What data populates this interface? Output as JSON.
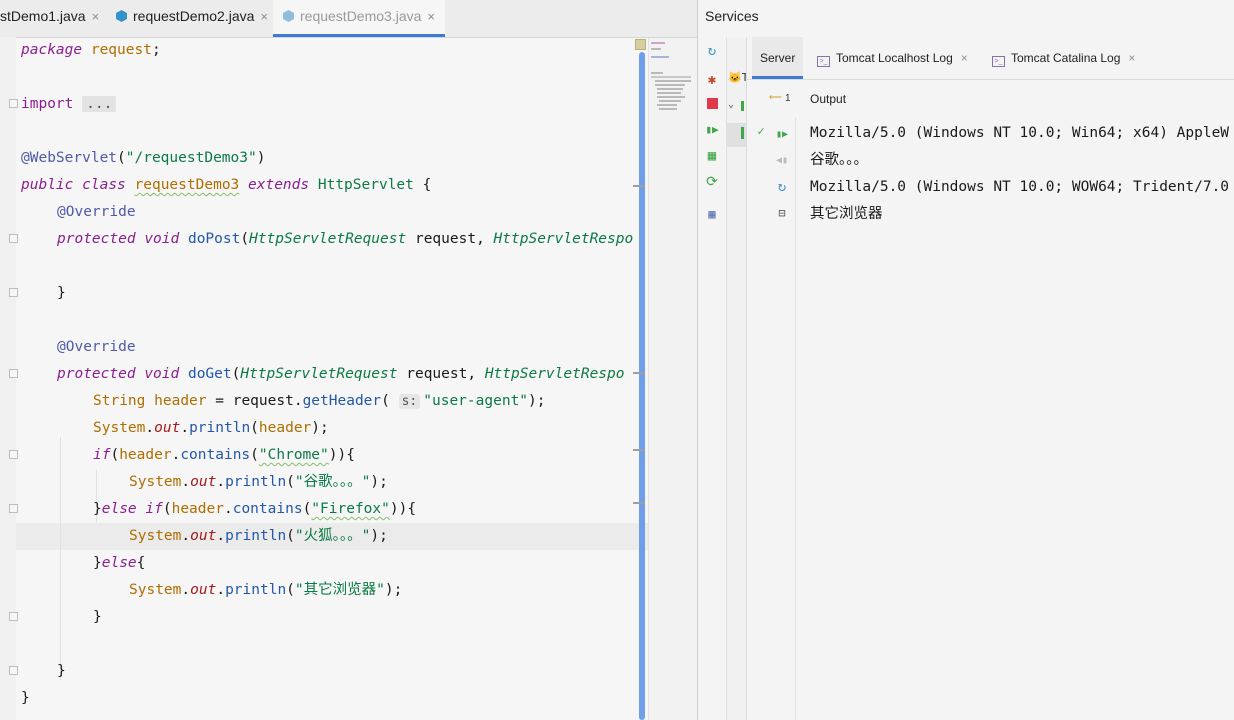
{
  "editor": {
    "tabs": [
      {
        "label": "stDemo1.java",
        "close": "×"
      },
      {
        "label": "requestDemo2.java",
        "close": "×"
      },
      {
        "label": "requestDemo3.java",
        "close": "×"
      }
    ],
    "code": {
      "package_kw": "package",
      "package_name": "request",
      "semicolon": ";",
      "import_kw": "import",
      "import_dots": "...",
      "ann_webservlet": "@WebServlet",
      "webservlet_paren_open": "(",
      "webservlet_path": "\"/requestDemo3\"",
      "webservlet_paren_close": ")",
      "public_kw": "public",
      "class_kw": "class",
      "class_name": "requestDemo3",
      "extends_kw": "extends",
      "super_class": "HttpServlet",
      "brace_open": "{",
      "override": "@Override",
      "protected_kw": "protected",
      "void_kw": "void",
      "do_post": "doPost",
      "param_type1": "HttpServletRequest",
      "param_request": "request,",
      "param_type2_post": "HttpServletRespo",
      "close_brace": "}",
      "do_get": "doGet",
      "param_type2_get": "HttpServletRespo",
      "string_type": "String",
      "header_var": "header",
      "equals": "=",
      "request_obj": "request",
      "get_header": "getHeader",
      "hint_s": "s:",
      "user_agent": "\"user-agent\"",
      "stmt_end": ");",
      "system": "System",
      "out": "out",
      "println": "println",
      "dot": ".",
      "if_kw": "if",
      "else_kw": "else",
      "contains": "contains",
      "chrome": "\"Chrome\"",
      "firefox": "\"Firefox\"",
      "msg_chrome": "\"谷歌。。。\"",
      "msg_firefox": "\"火狐。。。\"",
      "msg_other": "\"其它浏览器\""
    }
  },
  "services": {
    "title": "Services",
    "tree_node_label": "T",
    "log_tabs": [
      {
        "label": "Server"
      },
      {
        "label": "Tomcat Localhost Log",
        "close": "×"
      },
      {
        "label": "Tomcat Catalina Log",
        "close": "×"
      }
    ],
    "output_label": "Output",
    "output_indicator": "1",
    "output_lines": [
      "Mozilla/5.0 (Windows NT 10.0; Win64; x64) AppleW",
      "谷歌。。。",
      "Mozilla/5.0 (Windows NT 10.0; WOW64; Trident/7.0",
      "其它浏览器"
    ]
  }
}
